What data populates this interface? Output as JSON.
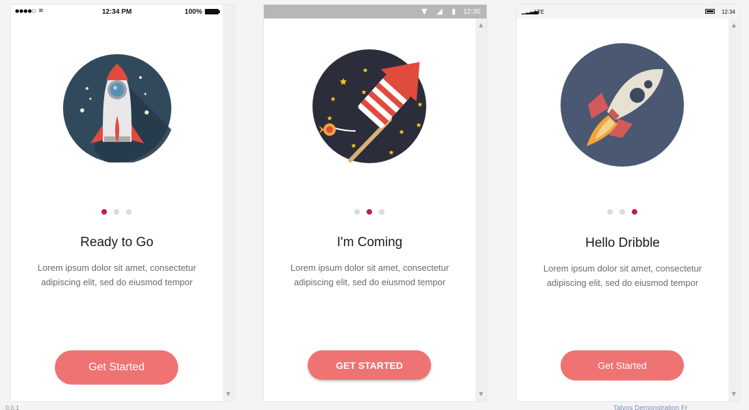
{
  "screens": [
    {
      "platform": "ios",
      "status": {
        "signal": "●●●●○",
        "wifi": "≋",
        "time": "12:34 PM",
        "battery": "100%"
      },
      "title": "Ready to Go",
      "body": "Lorem ipsum dolor sit amet, consectetur adipiscing elit, sed do eiusmod tempor",
      "button": "Get Started",
      "active_page": 1,
      "page_count": 3,
      "illustration": "rocket-icon"
    },
    {
      "platform": "android",
      "status": {
        "wifi": "▼",
        "signal": "◢",
        "battery": "▮",
        "time": "12:30"
      },
      "title": "I'm Coming",
      "body": "Lorem ipsum dolor sit amet, consectetur adipiscing elit, sed do eiusmod tempor",
      "button": "GET STARTED",
      "active_page": 2,
      "page_count": 3,
      "illustration": "firework-icon"
    },
    {
      "platform": "windows",
      "status": {
        "signal": "▁▂▃▄",
        "network": "LTE",
        "time": "12:34"
      },
      "title": "Hello Dribble",
      "body": "Lorem ipsum dolor sit amet, consectetur adipiscing elit, sed do eiusmod tempor",
      "button": "Get Started",
      "active_page": 3,
      "page_count": 3,
      "illustration": "launching-rocket-icon"
    }
  ],
  "footer": {
    "left": "0.0.1",
    "right": "Talvos Demonstration Fr"
  },
  "colors": {
    "accent": "#c2185b",
    "button": "#ef7373",
    "dot_inactive": "#dadada"
  }
}
